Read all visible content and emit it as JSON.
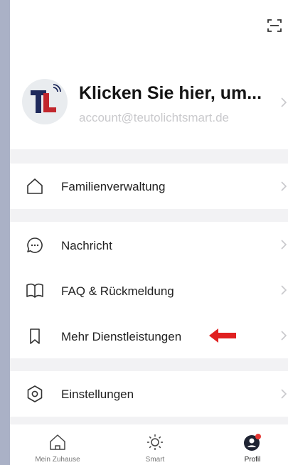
{
  "header": {
    "profile_name": "Klicken Sie hier, um...",
    "profile_email": "account@teutolichtsmart.de"
  },
  "menu": {
    "family": {
      "label": "Familienverwaltung"
    },
    "message": {
      "label": "Nachricht"
    },
    "faq": {
      "label": "FAQ & Rückmeldung"
    },
    "services": {
      "label": "Mehr Dienstleistungen"
    },
    "settings": {
      "label": "Einstellungen"
    }
  },
  "tabbar": {
    "tabs": [
      {
        "label": "Mein Zuhause",
        "icon": "home-icon",
        "active": false
      },
      {
        "label": "Smart",
        "icon": "sun-icon",
        "active": false
      },
      {
        "label": "Profil",
        "icon": "profile-icon",
        "active": true
      }
    ]
  },
  "colors": {
    "annotation_arrow": "#e02020",
    "notification_dot": "#e53935",
    "avatar_red": "#c1272d",
    "avatar_navy": "#1f2a5c"
  }
}
